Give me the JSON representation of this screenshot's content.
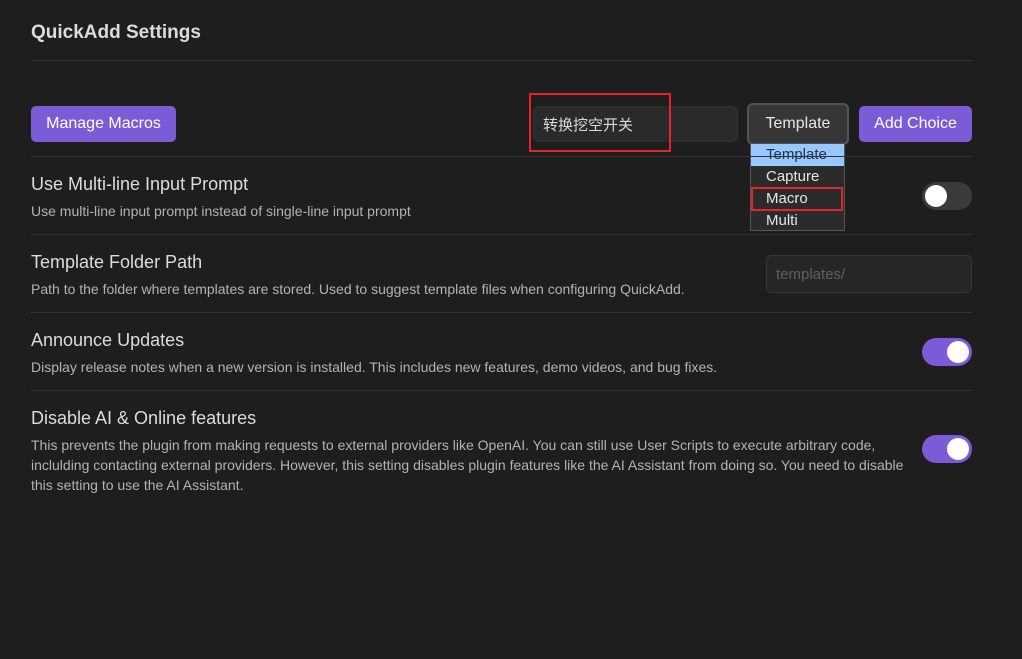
{
  "header": {
    "title": "QuickAdd Settings"
  },
  "toolbar": {
    "manage_macros_label": "Manage Macros",
    "choice_name_value": "转换挖空开关",
    "choice_type_selected": "Template",
    "add_choice_label": "Add Choice"
  },
  "type_dropdown": {
    "options": [
      "Template",
      "Capture",
      "Macro",
      "Multi"
    ],
    "highlighted": "Template",
    "annotated": "Macro"
  },
  "settings": [
    {
      "name": "Use Multi-line Input Prompt",
      "description": "Use multi-line input prompt instead of single-line input prompt",
      "control": "toggle",
      "enabled": false
    },
    {
      "name": "Template Folder Path",
      "description": "Path to the folder where templates are stored. Used to suggest template files when configuring QuickAdd.",
      "control": "text-input",
      "value": "",
      "placeholder": "templates/"
    },
    {
      "name": "Announce Updates",
      "description": "Display release notes when a new version is installed. This includes new features, demo videos, and bug fixes.",
      "control": "toggle",
      "enabled": true
    },
    {
      "name": "Disable AI & Online features",
      "description": "This prevents the plugin from making requests to external providers like OpenAI. You can still use User Scripts to execute arbitrary code, inclulding contacting external providers. However, this setting disables plugin features like the AI Assistant from doing so. You need to disable this setting to use the AI Assistant.",
      "control": "toggle",
      "enabled": true
    }
  ],
  "colors": {
    "accent": "#7c5bd6",
    "annotation": "#e0262b",
    "dropdown_highlight": "#99c8ff"
  }
}
